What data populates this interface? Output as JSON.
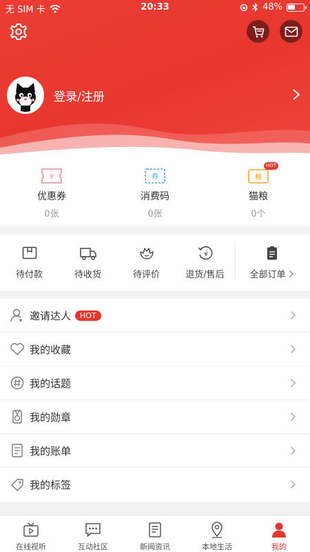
{
  "status_bar": {
    "carrier": "无 SIM 卡",
    "time": "20:33",
    "battery": "48%"
  },
  "profile": {
    "login_label": "登录/注册"
  },
  "assets": [
    {
      "name": "优惠券",
      "value": "0张",
      "icon": "coupon-icon",
      "badge": ""
    },
    {
      "name": "消费码",
      "value": "0张",
      "icon": "voucher-icon",
      "badge": ""
    },
    {
      "name": "猫粮",
      "value": "0个",
      "icon": "cat-food-icon",
      "badge": "HOT"
    }
  ],
  "assets_icon_text": {
    "coupon": "¥",
    "voucher": "券",
    "catfood": "粮"
  },
  "orders": [
    {
      "label": "待付款",
      "icon": "wallet-icon"
    },
    {
      "label": "待收货",
      "icon": "truck-icon"
    },
    {
      "label": "待评价",
      "icon": "review-icon"
    },
    {
      "label": "退货/售后",
      "icon": "refund-icon"
    },
    {
      "label": "全部订单",
      "icon": "clipboard-icon"
    }
  ],
  "menu": [
    {
      "label": "邀请达人",
      "icon": "invite-icon",
      "badge": "HOT"
    },
    {
      "label": "我的收藏",
      "icon": "heart-icon"
    },
    {
      "label": "我的话题",
      "icon": "hashtag-icon"
    },
    {
      "label": "我的勋章",
      "icon": "medal-icon"
    },
    {
      "label": "我的账单",
      "icon": "bill-icon"
    },
    {
      "label": "我的标签",
      "icon": "tag-icon"
    }
  ],
  "tabs": [
    {
      "label": "在线视听",
      "icon": "tv-icon",
      "active": false
    },
    {
      "label": "互动社区",
      "icon": "chat-icon",
      "active": false
    },
    {
      "label": "新闻资讯",
      "icon": "news-icon",
      "active": false
    },
    {
      "label": "本地生活",
      "icon": "location-icon",
      "active": false
    },
    {
      "label": "我的",
      "icon": "person-icon",
      "active": true
    }
  ],
  "colors": {
    "accent": "#e8372e",
    "icon_dark": "#7c1f1a",
    "tab_active": "#e8372e"
  }
}
